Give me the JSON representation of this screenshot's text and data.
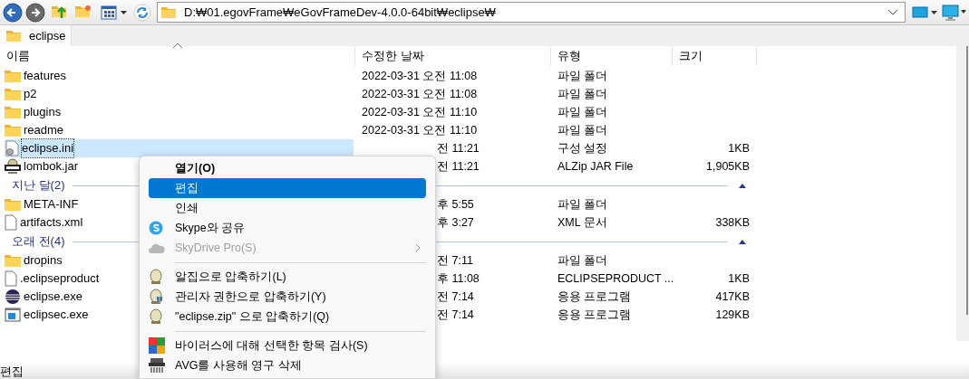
{
  "toolbar": {
    "address": "D:₩01.egovFrame₩eGovFrameDev-4.0.0-64bit₩eclipse₩"
  },
  "tabs": [
    {
      "label": "eclipse",
      "selected": true
    }
  ],
  "columns": [
    {
      "label": "이름",
      "sorted": true
    },
    {
      "label": "수정한 날짜",
      "sorted": false
    },
    {
      "label": "유형",
      "sorted": false
    },
    {
      "label": "크기",
      "sorted": false
    }
  ],
  "items": [
    {
      "kind": "folder",
      "name": "features",
      "date": "2022-03-31 오전 11:08",
      "type": "파일 폴더",
      "selected": false
    },
    {
      "kind": "folder",
      "name": "p2",
      "date": "2022-03-31 오전 11:08",
      "type": "파일 폴더",
      "selected": false
    },
    {
      "kind": "folder",
      "name": "plugins",
      "date": "2022-03-31 오전 11:10",
      "type": "파일 폴더",
      "selected": false
    },
    {
      "kind": "folder",
      "name": "readme",
      "date": "2022-03-31 오전 11:10",
      "type": "파일 폴더",
      "selected": false
    },
    {
      "kind": "settings",
      "name": "eclipse.ini",
      "date": "전 11:21",
      "date_covered": true,
      "type": "구성 설정",
      "size": "1KB",
      "selected": true
    },
    {
      "kind": "jar",
      "name": "lombok.jar",
      "date": "전 11:21",
      "date_covered": true,
      "type": "ALZip JAR File",
      "size": "1,905KB",
      "selected": false
    },
    {
      "kind": "group",
      "label": "지난 달(2)",
      "expanded": true
    },
    {
      "kind": "folder",
      "name": "META-INF",
      "date": "후 5:55",
      "date_covered": true,
      "type": "파일 폴더",
      "selected": false
    },
    {
      "kind": "document",
      "name": "artifacts.xml",
      "date": "후 3:27",
      "date_covered": true,
      "type": "XML 문서",
      "size": "338KB",
      "selected": false
    },
    {
      "kind": "group",
      "label": "오래 전(4)",
      "expanded": true
    },
    {
      "kind": "folder",
      "name": "dropins",
      "date": "전 7:11",
      "date_covered": true,
      "type": "파일 폴더",
      "selected": false
    },
    {
      "kind": "document",
      "name": ".eclipseproduct",
      "date": "후 11:08",
      "date_covered": true,
      "type": "ECLIPSEPRODUCT ...",
      "size": "1KB",
      "selected": false
    },
    {
      "kind": "eclipse",
      "name": "eclipse.exe",
      "date": "전 7:14",
      "date_covered": true,
      "type": "응용 프로그램",
      "size": "417KB",
      "selected": false
    },
    {
      "kind": "app",
      "name": "eclipsec.exe",
      "date": "전 7:14",
      "date_covered": true,
      "type": "응용 프로그램",
      "size": "129KB",
      "selected": false
    }
  ],
  "context_menu": {
    "items": [
      {
        "kind": "plain",
        "label": "열기(O)",
        "default": true,
        "selected": false,
        "disabled": false
      },
      {
        "kind": "plain",
        "label": "편집",
        "selected": true,
        "disabled": false
      },
      {
        "kind": "plain",
        "label": "인쇄",
        "selected": false,
        "disabled": false
      },
      {
        "kind": "skype",
        "label": "Skype와 공유",
        "selected": false,
        "disabled": false
      },
      {
        "kind": "cloud",
        "label": "SkyDrive Pro(S)",
        "selected": false,
        "disabled": true,
        "submenu": true
      },
      {
        "kind": "separator"
      },
      {
        "kind": "zip",
        "label": "알집으로 압축하기(L)",
        "selected": false,
        "disabled": false
      },
      {
        "kind": "zip-admin",
        "label": "관리자 권한으로 압축하기(Y)",
        "selected": false,
        "disabled": false
      },
      {
        "kind": "zip",
        "label": "\"eclipse.zip\" 으로 압축하기(Q)",
        "selected": false,
        "disabled": false
      },
      {
        "kind": "separator"
      },
      {
        "kind": "scan",
        "label": "바이러스에 대해 선택한 항목 검사(S)",
        "selected": false,
        "disabled": false
      },
      {
        "kind": "shredder",
        "label": "AVG를 사용해 영구 삭제",
        "selected": false,
        "disabled": false
      }
    ]
  },
  "status_bar": {
    "text": "편집"
  }
}
